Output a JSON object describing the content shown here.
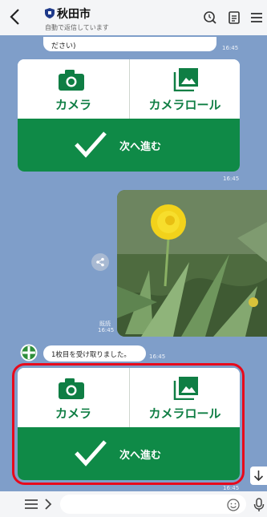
{
  "header": {
    "title": "秋田市",
    "subtitle": "自動で返信しています",
    "icons": [
      "back-icon",
      "shield-icon",
      "search-clock-icon",
      "notes-icon",
      "menu-icon"
    ]
  },
  "chat": {
    "top_bubble_text": "ださい)",
    "time_top": "16:45",
    "card1": {
      "camera_label": "カメラ",
      "roll_label": "カメラロール",
      "next_label": "次へ進む",
      "time": "16:45"
    },
    "photo": {
      "status": "既読",
      "time": "16:45"
    },
    "bot_message": "1枚目を受け取りました。",
    "bot_message_time": "16:45",
    "card2": {
      "camera_label": "カメラ",
      "roll_label": "カメラロール",
      "next_label": "次へ進む",
      "time": "16:45"
    }
  },
  "footer": {
    "input_placeholder": ""
  },
  "colors": {
    "chat_bg": "#7f9ec9",
    "brand_green": "#0f8a47",
    "highlight_red": "#e8091b"
  }
}
